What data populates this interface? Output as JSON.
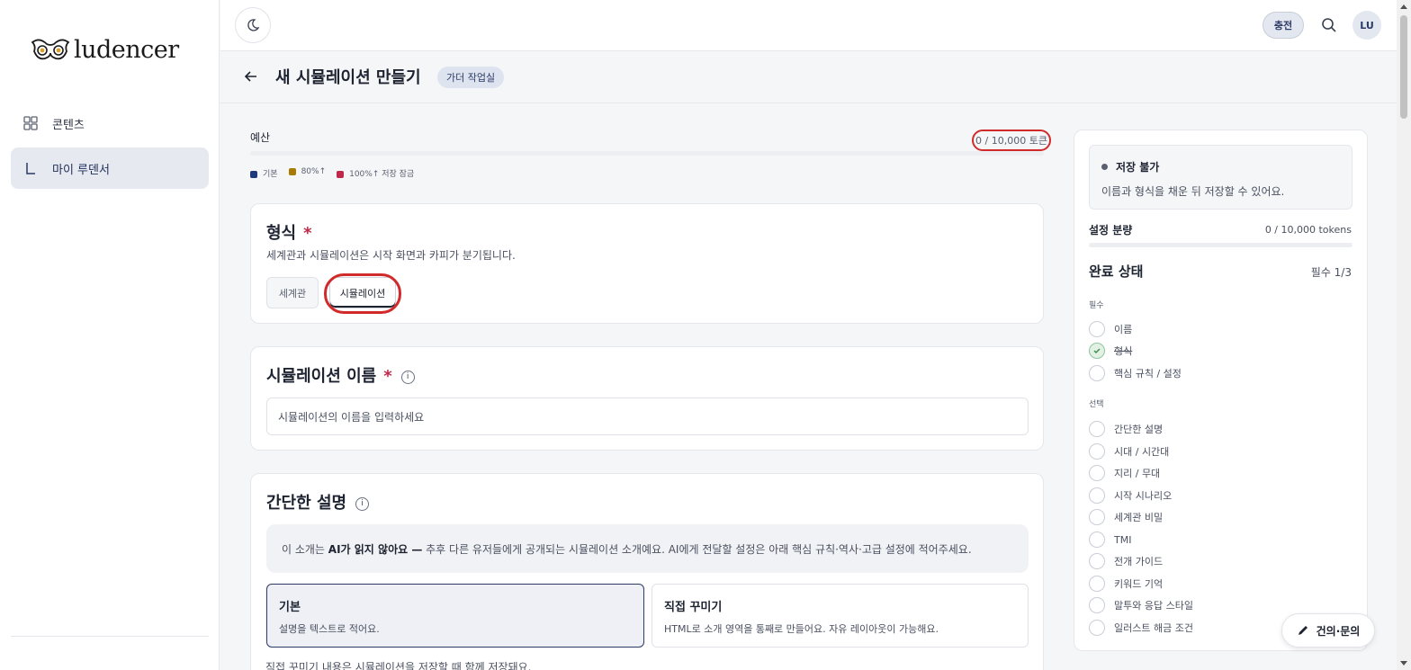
{
  "app": {
    "logo_text": "ludencer",
    "nav": [
      {
        "label": "콘텐츠",
        "icon": "grid-icon",
        "active": false
      },
      {
        "label": "마이 루덴서",
        "icon": "corner-icon",
        "active": true
      }
    ]
  },
  "topbar": {
    "charge_label": "충전",
    "avatar_initials": "LU"
  },
  "header": {
    "title": "새 시뮬레이션 만들기",
    "badge": "가더 작업실"
  },
  "budget": {
    "label": "예산",
    "count": "0 / 10,000 토큰",
    "legend": [
      {
        "label": "기본",
        "color": "#1f3a7a"
      },
      {
        "label": "80%↑",
        "color": "#a87a00"
      },
      {
        "label": "100%↑ 저장 잠금",
        "color": "#c0284a"
      }
    ]
  },
  "format": {
    "title": "형식",
    "required_mark": "*",
    "desc": "세계관과 시뮬레이션은 시작 화면과 카피가 분기됩니다.",
    "options": [
      {
        "label": "세계관",
        "selected": false
      },
      {
        "label": "시뮬레이션",
        "selected": true
      }
    ]
  },
  "name_field": {
    "title": "시뮬레이션 이름",
    "required_mark": "*",
    "info": "i",
    "placeholder": "시뮬레이션의 이름을 입력하세요"
  },
  "description": {
    "title": "간단한 설명",
    "info": "i",
    "notice_prefix": "이 소개는 ",
    "notice_bold": "AI가 읽지 않아요 —",
    "notice_suffix": " 추후 다른 유저들에게 공개되는 시뮬레이션 소개예요. AI에게 전달할 설정은 아래 핵심 규칙·역사·고급 설정에 적어주세요.",
    "modes": [
      {
        "title": "기본",
        "sub": "설명을 텍스트로 적어요.",
        "selected": true
      },
      {
        "title": "직접 꾸미기",
        "sub": "HTML로 소개 영역을 통째로 만들어요. 자유 레이아웃이 가능해요.",
        "selected": false
      }
    ],
    "footnote": "직접 꾸미기 내용은 시뮬레이션을 저장할 때 함께 저장돼요."
  },
  "panel": {
    "status_title": "저장 불가",
    "status_desc": "이름과 형식을 채운 뒤 저장할 수 있어요.",
    "alloc_label": "설정 분량",
    "alloc_value": "0 / 10,000 tokens",
    "done_title": "완료 상태",
    "done_count": "필수 1/3",
    "required_label": "필수",
    "required_items": [
      {
        "label": "이름",
        "done": false
      },
      {
        "label": "형식",
        "done": true
      },
      {
        "label": "핵심 규칙 / 설정",
        "done": false
      }
    ],
    "optional_label": "선택",
    "optional_items": [
      {
        "label": "간단한 설명"
      },
      {
        "label": "시대 / 시간대"
      },
      {
        "label": "지리 / 무대"
      },
      {
        "label": "시작 시나리오"
      },
      {
        "label": "세계관 비밀"
      },
      {
        "label": "TMI"
      },
      {
        "label": "전개 가이드"
      },
      {
        "label": "키워드 기억"
      },
      {
        "label": "말투와 응답 스타일"
      },
      {
        "label": "일러스트 해금 조건"
      }
    ]
  },
  "feedback": {
    "label": "건의·문의"
  }
}
